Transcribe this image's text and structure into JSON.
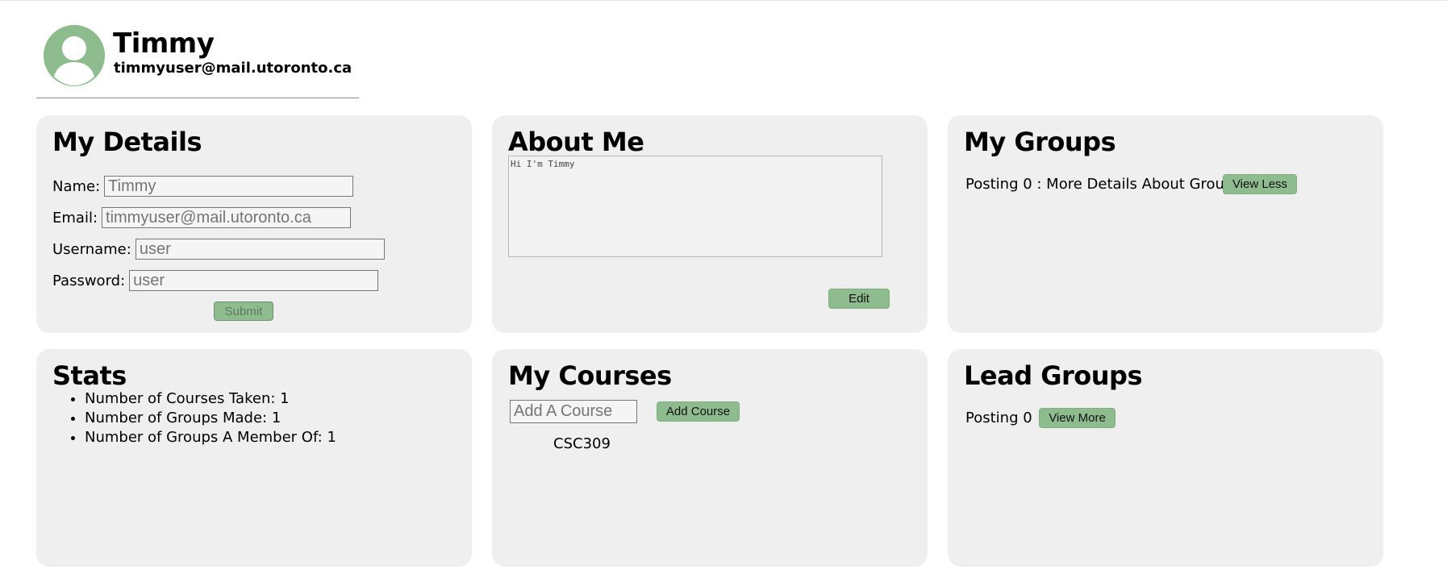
{
  "profile": {
    "name": "Timmy",
    "email": "timmyuser@mail.utoronto.ca",
    "avatar_icon": "user-avatar-icon"
  },
  "my_details": {
    "title": "My Details",
    "fields": [
      {
        "label": "Name:",
        "placeholder": "Timmy"
      },
      {
        "label": "Email:",
        "placeholder": "timmyuser@mail.utoronto.ca"
      },
      {
        "label": "Username:",
        "placeholder": "user"
      },
      {
        "label": "Password:",
        "placeholder": "user"
      }
    ],
    "submit_label": "Submit"
  },
  "about_me": {
    "title": "About Me",
    "text": "Hi I'm Timmy",
    "edit_label": "Edit"
  },
  "my_groups": {
    "title": "My Groups",
    "posting_text": "Posting 0 : More Details About Group",
    "button_label": "View Less"
  },
  "stats": {
    "title": "Stats",
    "items": [
      "Number of Courses Taken: 1",
      "Number of Groups Made: 1",
      "Number of Groups A Member Of: 1"
    ]
  },
  "my_courses": {
    "title": "My Courses",
    "input_placeholder": "Add A Course",
    "add_label": "Add Course",
    "courses": [
      "CSC309"
    ]
  },
  "lead_groups": {
    "title": "Lead Groups",
    "posting_text": "Posting 0",
    "button_label": "View More"
  },
  "colors": {
    "accent_green": "#8fbc8f",
    "card_bg": "#efefef"
  }
}
